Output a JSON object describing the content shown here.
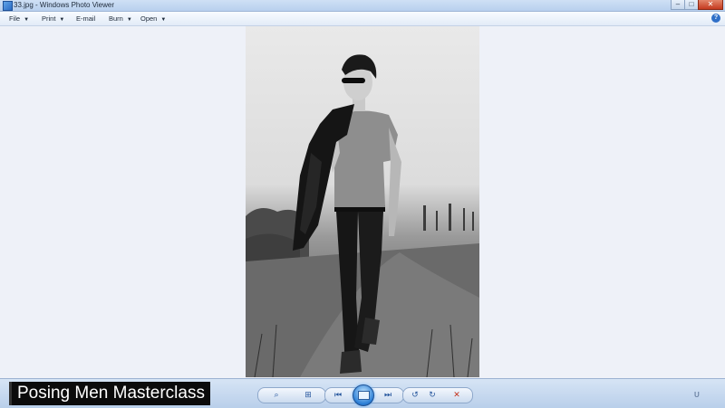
{
  "window": {
    "title": "33.jpg - Windows Photo Viewer",
    "controls": {
      "minimize": "–",
      "maximize": "□",
      "close": "✕"
    }
  },
  "menubar": {
    "items": [
      {
        "label": "File"
      },
      {
        "label": "Print"
      },
      {
        "label": "E-mail"
      },
      {
        "label": "Burn"
      },
      {
        "label": "Open"
      }
    ],
    "help_icon": "?"
  },
  "photo": {
    "subject": "black-and-white photo of a man in sunglasses walking on a grassy path carrying a leather jacket over his shoulder"
  },
  "overlay": {
    "caption": "Posing Men Masterclass"
  },
  "toolbar": {
    "icons": {
      "zoom": "zoom-icon",
      "fit": "actual-size-icon",
      "previous": "previous-icon",
      "slideshow": "play-slideshow-icon",
      "next": "next-icon",
      "rotate_ccw": "rotate-counterclockwise-icon",
      "rotate_cw": "rotate-clockwise-icon",
      "delete": "delete-icon"
    },
    "glyphs": {
      "zoom": "⌕",
      "fit": "⊞",
      "previous": "⏮",
      "next": "⏭",
      "rotate_ccw": "↺",
      "rotate_cw": "↻",
      "delete": "✕"
    }
  }
}
